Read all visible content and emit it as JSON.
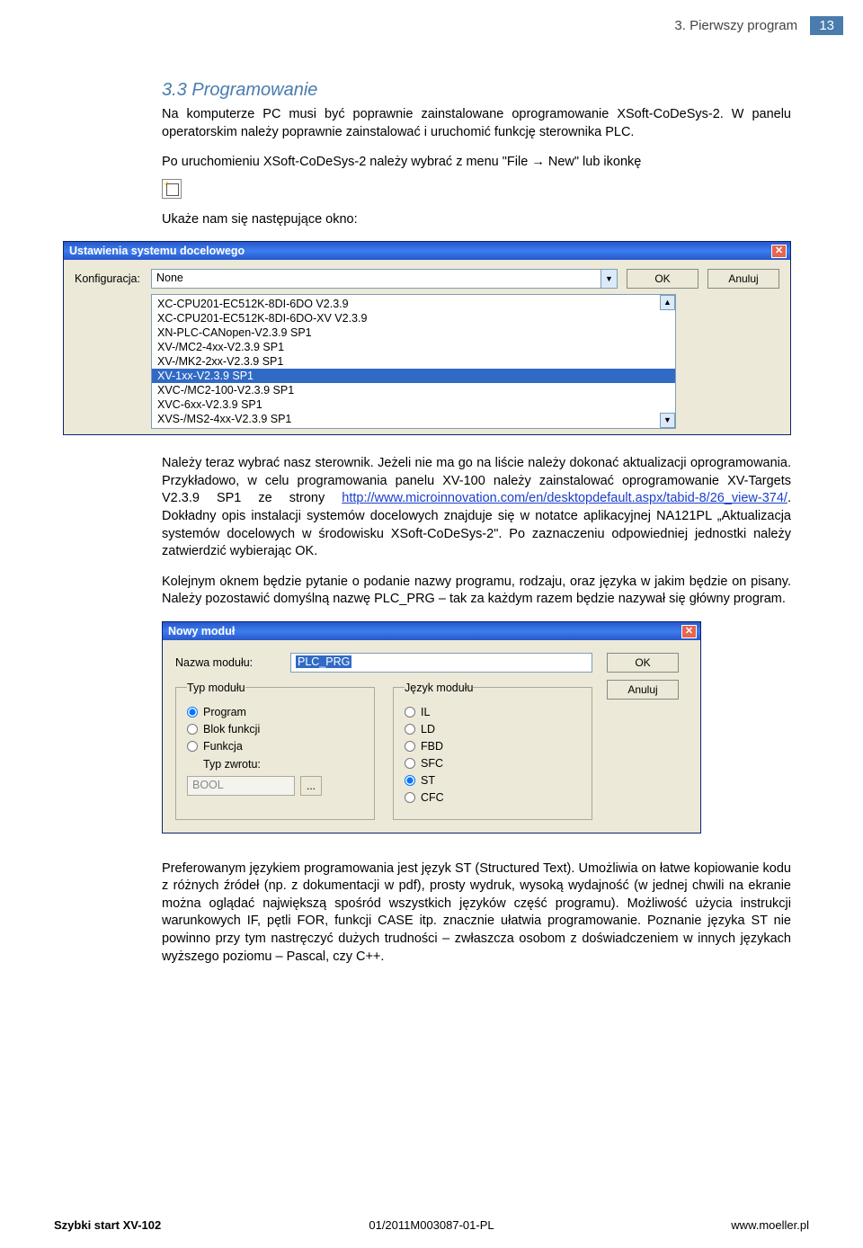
{
  "header": {
    "section": "3. Pierwszy program",
    "page_num": "13"
  },
  "section_title": "3.3  Programowanie",
  "para1": "Na  komputerze PC musi być poprawnie zainstalowane oprogramowanie XSoft-CoDeSys-2. W panelu operatorskim należy poprawnie zainstalować i uruchomić funkcję sterownika PLC.",
  "para2": "Po uruchomieniu XSoft-CoDeSys-2  należy wybrać z menu \"File → New\" lub ikonkę",
  "para3": "Ukaże nam się następujące okno:",
  "win1": {
    "title": "Ustawienia systemu docelowego",
    "config_label": "Konfiguracja:",
    "config_value": "None",
    "ok": "OK",
    "cancel": "Anuluj",
    "options": [
      "XC-CPU201-EC512K-8DI-6DO V2.3.9",
      "XC-CPU201-EC512K-8DI-6DO-XV V2.3.9",
      "XN-PLC-CANopen-V2.3.9 SP1",
      "XV-/MC2-4xx-V2.3.9 SP1",
      "XV-/MK2-2xx-V2.3.9 SP1",
      "XV-1xx-V2.3.9 SP1",
      "XVC-/MC2-100-V2.3.9 SP1",
      "XVC-6xx-V2.3.9 SP1",
      "XVS-/MS2-4xx-V2.3.9 SP1"
    ],
    "selected_index": 5
  },
  "para4a": "Należy teraz wybrać nasz sterownik. Jeżeli nie ma go na liście należy dokonać aktualizacji  oprogramowania.  Przykładowo, w celu programowania panelu XV-100 należy   zainstalować   oprogramowanie   XV-Targets   V2.3.9   SP1   ze   strony ",
  "link": "http://www.microinnovation.com/en/desktopdefault.aspx/tabid-8/26_view-374/",
  "para4b": ". Dokładny opis instalacji systemów docelowych znajduje się w notatce aplikacyjnej NA121PL „Aktualizacja systemów docelowych w środowisku XSoft-CoDeSys-2\". Po  zaznaczeniu  odpowiedniej  jednostki  należy  zatwierdzić wybierając OK.",
  "para5": "Kolejnym  oknem  będzie  pytanie  o  podanie  nazwy  programu,  rodzaju, oraz  języka w jakim będzie on pisany. Należy pozostawić domyślną nazwę PLC_PRG – tak za każdym razem będzie nazywał się główny program.",
  "win2": {
    "title": "Nowy moduł",
    "name_label": "Nazwa modułu:",
    "name_value": "PLC_PRG",
    "ok": "OK",
    "cancel": "Anuluj",
    "group_type": "Typ modułu",
    "type_options": [
      "Program",
      "Blok funkcji",
      "Funkcja"
    ],
    "type_selected": 0,
    "type_return_label": "Typ zwrotu:",
    "type_return_value": "BOOL",
    "group_lang": "Język modułu",
    "lang_options": [
      "IL",
      "LD",
      "FBD",
      "SFC",
      "ST",
      "CFC"
    ],
    "lang_selected": 4
  },
  "para6": "Preferowanym  językiem  programowania  jest  język  ST  (Structured  Text). Umożliwia  on  łatwe  kopiowanie  kodu  z różnych  źródeł  (np.  z dokumentacji  w pdf), prosty  wydruk,  wysoką  wydajność  (w  jednej  chwili  na  ekranie  można  oglądać największą spośród wszystkich języków część programu). Możliwość użycia instrukcji warunkowych  IF,  pętli  FOR,  funkcji  CASE  itp.  znacznie  ułatwia programowanie. Poznanie języka ST nie powinno przy tym nastręczyć dużych trudności – zwłaszcza osobom z doświadczeniem w innych językach wyższego poziomu – Pascal, czy C++.",
  "footer": {
    "left": "Szybki start XV-102",
    "mid": "01/2011M003087-01-PL",
    "right": "www.moeller.pl"
  }
}
